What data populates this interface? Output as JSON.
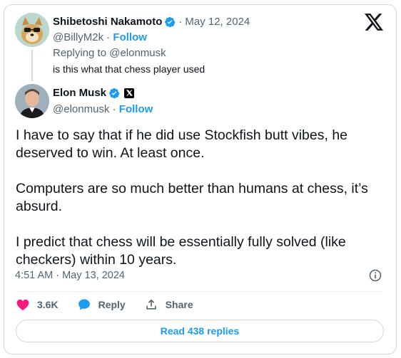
{
  "reply": {
    "name": "Shibetoshi Nakamoto",
    "dot": "·",
    "date": "May 12, 2024",
    "handle": "@BillyM2k",
    "follow_sep": "·",
    "follow": "Follow",
    "replying_prefix": "Replying to",
    "replying_to": "@elonmusk",
    "text": "is this what that chess player used"
  },
  "main": {
    "name": "Elon Musk",
    "handle": "@elonmusk",
    "follow_sep": "·",
    "follow": "Follow",
    "paragraphs": [
      "I have to say that if he did use Stockfish butt vibes, he deserved to win. At least once.",
      "Computers are so much better than humans at chess, it’s absurd.",
      "I predict that chess will be essentially fully solved (like checkers) within 10 years."
    ],
    "timestamp": "4:51 AM · May 13, 2024"
  },
  "actions": {
    "likes": "3.6K",
    "reply": "Reply",
    "share": "Share"
  },
  "read_replies": "Read 438 replies",
  "colors": {
    "accent": "#1d9bf0",
    "like": "#f91880",
    "text": "#0f1419",
    "muted": "#536471"
  }
}
